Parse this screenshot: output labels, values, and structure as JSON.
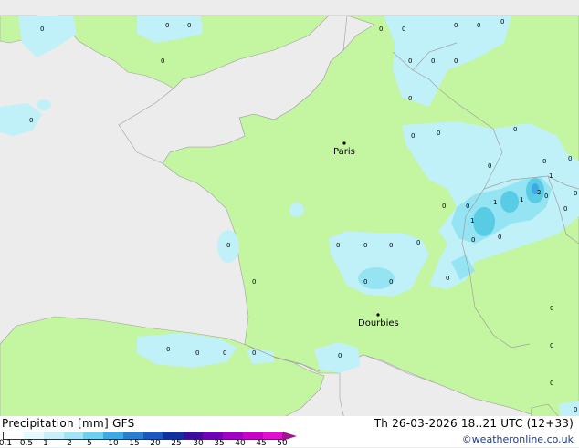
{
  "map": {
    "cities": [
      {
        "name": "Paris"
      },
      {
        "name": "Dourbies"
      }
    ],
    "values": [
      "0",
      "0",
      "0",
      "0",
      "0",
      "0",
      "0",
      "0",
      "0",
      "0",
      "0",
      "0",
      "0",
      "0",
      "0",
      "0",
      "0",
      "0",
      "0",
      "0",
      "0",
      "0",
      "0",
      "0",
      "0",
      "0",
      "0",
      "0",
      "0",
      "0",
      "0",
      "0",
      "0",
      "0",
      "0",
      "0",
      "1",
      "1",
      "2",
      "1",
      "1",
      "0",
      "0",
      "0",
      "0",
      "0",
      "0",
      "0",
      "0",
      "0",
      "0",
      "0",
      "1",
      "0",
      "0",
      "0",
      "0",
      "0",
      "0",
      "0"
    ],
    "colors": {
      "land": "#c4f5a0",
      "sea": "#ececec",
      "precip_light": "#c0f0f8",
      "precip_mid": "#94e4f4",
      "precip_heavy": "#58cce4",
      "border": "#a0a0a0"
    }
  },
  "legend": {
    "title": "Precipitation [mm]  GFS",
    "ticks": [
      "0.1",
      "0.5",
      "1",
      "2",
      "5",
      "10",
      "15",
      "20",
      "25",
      "30",
      "35",
      "40",
      "45",
      "50"
    ],
    "colors": [
      "#fefefe",
      "#e4fafe",
      "#c6f0fa",
      "#a2e4f6",
      "#6ed0f0",
      "#3caae4",
      "#2a80d0",
      "#1c56c0",
      "#10309e",
      "#3c0ca0",
      "#7000b8",
      "#a000c4",
      "#c800c8",
      "#e010d0"
    ]
  },
  "footer": {
    "date": "Th 26-03-2026 18..21 UTC (12+33)",
    "credit": "©weatheronline.co.uk"
  }
}
